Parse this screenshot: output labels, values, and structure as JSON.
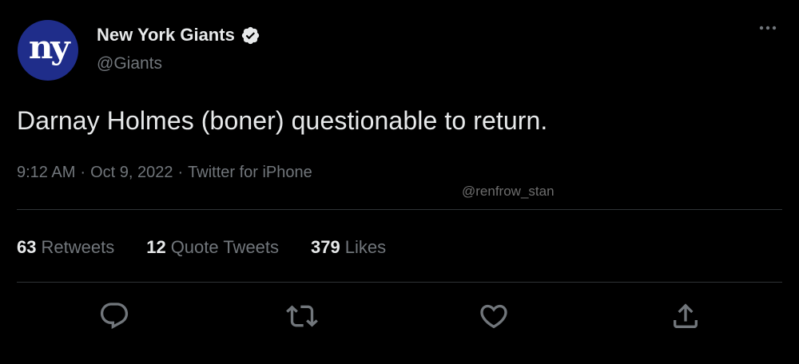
{
  "tweet": {
    "author": {
      "avatar_text": "ny",
      "display_name": "New York Giants",
      "verified": true,
      "handle": "@Giants"
    },
    "text": "Darnay Holmes (boner) questionable to return.",
    "meta": {
      "time": "9:12 AM",
      "separator": "·",
      "date": "Oct 9, 2022",
      "source": "Twitter for iPhone"
    },
    "watermark": "@renfrow_stan",
    "stats": [
      {
        "count": "63",
        "label": "Retweets"
      },
      {
        "count": "12",
        "label": "Quote Tweets"
      },
      {
        "count": "379",
        "label": "Likes"
      }
    ],
    "actions": [
      "reply-icon",
      "retweet-icon",
      "like-icon",
      "share-icon"
    ]
  },
  "colors": {
    "background": "#000000",
    "primary_text": "#e7e9ea",
    "secondary_text": "#71767b",
    "divider": "#2f3336",
    "avatar_bg": "#1f2d8a"
  }
}
